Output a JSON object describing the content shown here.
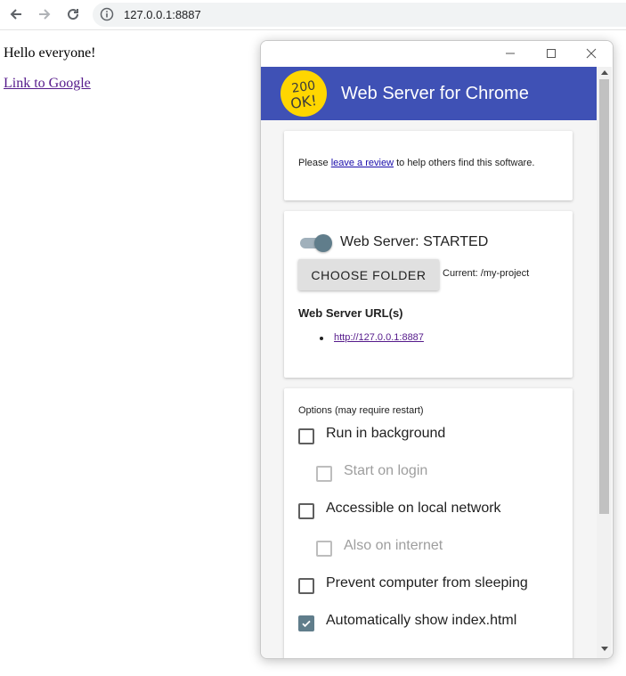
{
  "browser": {
    "url": "127.0.0.1:8887"
  },
  "page": {
    "greeting": "Hello everyone!",
    "link_text": "Link to Google"
  },
  "app": {
    "logo_line1": "200",
    "logo_line2": "OK!",
    "title": "Web Server for Chrome",
    "review": {
      "prefix": "Please ",
      "link": "leave a review",
      "suffix": " to help others find this software."
    },
    "server": {
      "status": "Web Server: STARTED",
      "toggle_on": true,
      "choose_folder": "CHOOSE FOLDER",
      "current_folder": "Current: /my-project",
      "urls_heading": "Web Server URL(s)",
      "urls": [
        "http://127.0.0.1:8887"
      ]
    },
    "options": {
      "heading": "Options (may require restart)",
      "items": [
        {
          "label": "Run in background",
          "checked": false,
          "disabled": false
        },
        {
          "label": "Start on login",
          "checked": false,
          "disabled": true
        },
        {
          "label": "Accessible on local network",
          "checked": false,
          "disabled": false
        },
        {
          "label": "Also on internet",
          "checked": false,
          "disabled": true
        },
        {
          "label": "Prevent computer from sleeping",
          "checked": false,
          "disabled": false
        },
        {
          "label": "Automatically show index.html",
          "checked": true,
          "disabled": false
        }
      ]
    },
    "colors": {
      "header": "#3f51b5",
      "accent": "#607d8b",
      "logo": "#ffd600"
    }
  }
}
